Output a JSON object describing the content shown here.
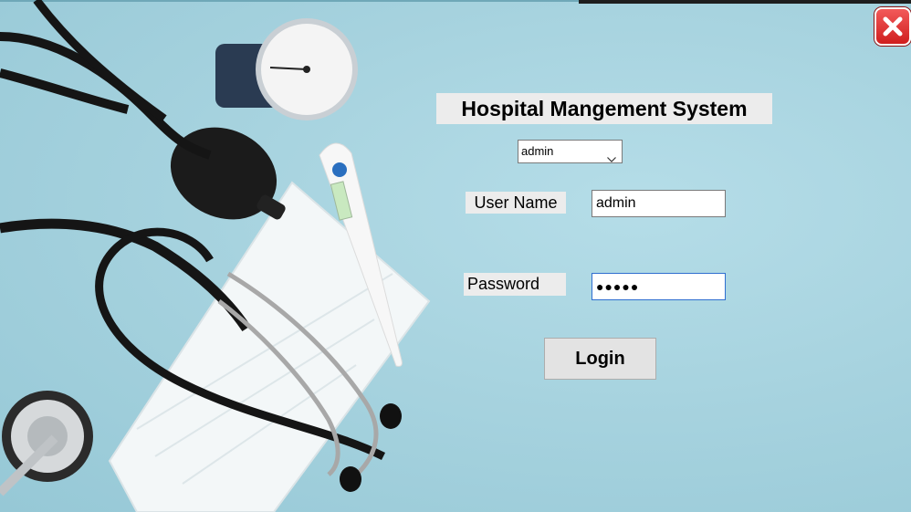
{
  "app": {
    "title": "Hospital Mangement System"
  },
  "role_select": {
    "value": "admin"
  },
  "username": {
    "label": "User Name",
    "value": "admin"
  },
  "password": {
    "label": "Password",
    "masked_value": "●●●●●"
  },
  "login_button": {
    "label": "Login"
  },
  "icons": {
    "close": "close-icon",
    "dropdown": "chevron-down-icon"
  },
  "colors": {
    "background": "#a9d4e0",
    "close_button": "#d01e1e",
    "label_bg": "#ececec"
  }
}
